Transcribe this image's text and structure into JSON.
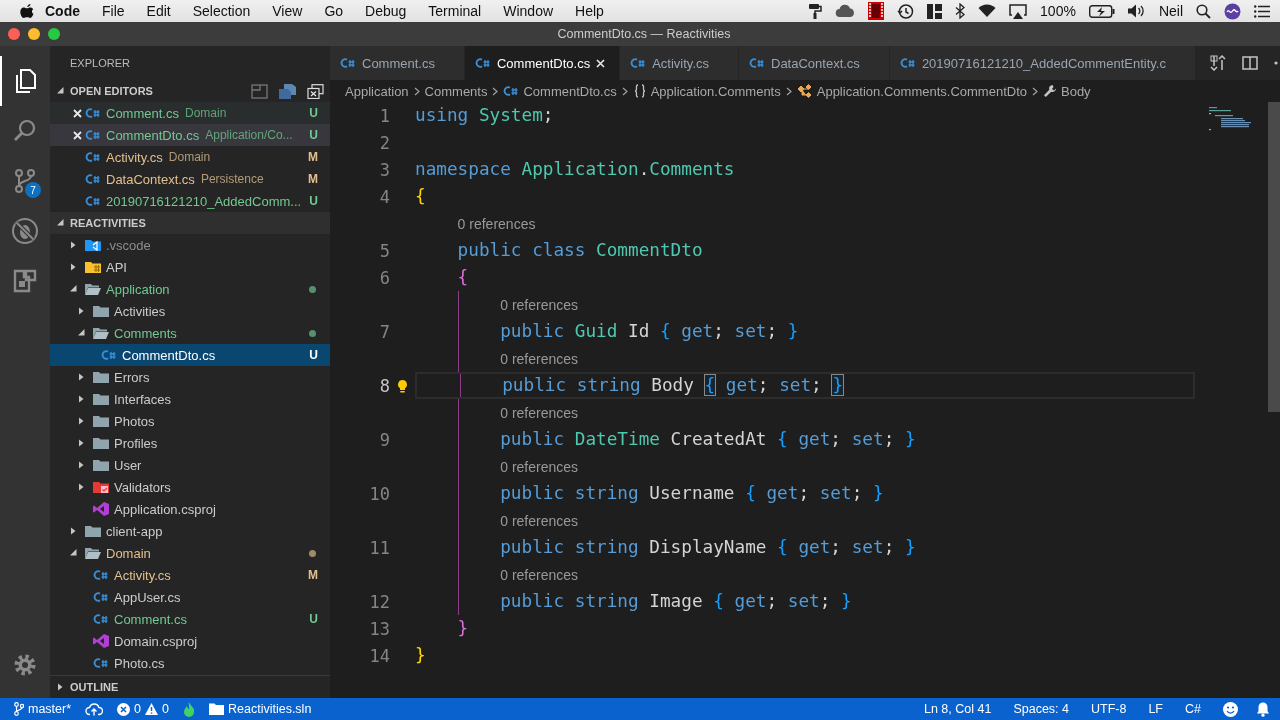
{
  "menubar": {
    "app": "Code",
    "menus": [
      "File",
      "Edit",
      "Selection",
      "View",
      "Go",
      "Debug",
      "Terminal",
      "Window",
      "Help"
    ],
    "battery": "100%",
    "user": "Neil"
  },
  "window": {
    "title": "CommentDto.cs — Reactivities"
  },
  "activity_bar": [
    {
      "kind": "explorer",
      "selected": true
    },
    {
      "kind": "search",
      "selected": false
    },
    {
      "kind": "scm",
      "selected": false,
      "badge": "7"
    },
    {
      "kind": "debug",
      "selected": false
    },
    {
      "kind": "extensions",
      "selected": false
    },
    {
      "kind": "settings",
      "selected": false
    }
  ],
  "sidebar": {
    "title": "EXPLORER",
    "open_editors": {
      "title": "OPEN EDITORS",
      "expanded": true,
      "items": [
        {
          "name": "Comment.cs",
          "detail": "Domain",
          "badge": "U",
          "color": "#73c991",
          "selected": false,
          "hovered": true
        },
        {
          "name": "CommentDto.cs",
          "detail": "Application/Co...",
          "badge": "U",
          "color": "#73c991",
          "selected": true,
          "hovered": false
        },
        {
          "name": "Activity.cs",
          "detail": "Domain",
          "badge": "M",
          "color": "#e2c08d",
          "selected": false,
          "hovered": false
        },
        {
          "name": "DataContext.cs",
          "detail": "Persistence",
          "badge": "M",
          "color": "#e2c08d",
          "selected": false,
          "hovered": false
        },
        {
          "name": "20190716121210_AddedComm...",
          "badge": "U",
          "color": "#73c991",
          "selected": false,
          "hovered": false
        }
      ]
    },
    "workspace": {
      "title": "REACTIVITIES",
      "expanded": true,
      "tree": [
        {
          "name": ".vscode",
          "kind": "vscode",
          "expanded": false,
          "selected": false,
          "changed": false,
          "color": "#8c8c8c"
        },
        {
          "name": "API",
          "kind": "api",
          "expanded": false,
          "selected": false,
          "changed": false,
          "color": "#cccccc"
        },
        {
          "name": "Application",
          "kind": "folder",
          "expanded": true,
          "selected": false,
          "changed": true,
          "color": "#73c991",
          "children": [
            {
              "name": "Activities",
              "kind": "folder",
              "expanded": false,
              "selected": false,
              "changed": false,
              "color": "#cccccc"
            },
            {
              "name": "Comments",
              "kind": "folder",
              "expanded": true,
              "selected": false,
              "changed": true,
              "color": "#73c991",
              "children": [
                {
                  "name": "CommentDto.cs",
                  "kind": "csharp",
                  "selected": true,
                  "color": "#ffffff",
                  "badge": "U"
                }
              ]
            },
            {
              "name": "Errors",
              "kind": "folder",
              "expanded": false,
              "selected": false,
              "changed": false,
              "color": "#cccccc"
            },
            {
              "name": "Interfaces",
              "kind": "folder",
              "expanded": false,
              "selected": false,
              "changed": false,
              "color": "#cccccc"
            },
            {
              "name": "Photos",
              "kind": "folder",
              "expanded": false,
              "selected": false,
              "changed": false,
              "color": "#cccccc"
            },
            {
              "name": "Profiles",
              "kind": "folder",
              "expanded": false,
              "selected": false,
              "changed": false,
              "color": "#cccccc"
            },
            {
              "name": "User",
              "kind": "folder",
              "expanded": false,
              "selected": false,
              "changed": false,
              "color": "#cccccc"
            },
            {
              "name": "Validators",
              "kind": "validators",
              "expanded": false,
              "selected": false,
              "changed": false,
              "color": "#cccccc"
            },
            {
              "name": "Application.csproj",
              "kind": "csproj",
              "selected": false,
              "color": "#cccccc"
            }
          ]
        },
        {
          "name": "client-app",
          "kind": "folder",
          "expanded": false,
          "selected": false,
          "changed": false,
          "color": "#cccccc"
        },
        {
          "name": "Domain",
          "kind": "folder",
          "expanded": true,
          "selected": false,
          "changed": true,
          "color": "#e2c08d",
          "children": [
            {
              "name": "Activity.cs",
              "kind": "csharp",
              "selected": false,
              "color": "#e2c08d",
              "badge": "M"
            },
            {
              "name": "AppUser.cs",
              "kind": "csharp",
              "selected": false,
              "color": "#cccccc"
            },
            {
              "name": "Comment.cs",
              "kind": "csharp",
              "selected": false,
              "color": "#73c991",
              "badge": "U"
            },
            {
              "name": "Domain.csproj",
              "kind": "csproj",
              "selected": false,
              "color": "#cccccc"
            },
            {
              "name": "Photo.cs",
              "kind": "csharp",
              "selected": false,
              "color": "#cccccc"
            }
          ]
        }
      ]
    },
    "outline": {
      "title": "OUTLINE",
      "expanded": false
    }
  },
  "editor": {
    "tabs": [
      {
        "label": "Comment.cs",
        "selected": false
      },
      {
        "label": "CommentDto.cs",
        "selected": true
      },
      {
        "label": "Activity.cs",
        "selected": false
      },
      {
        "label": "DataContext.cs",
        "selected": false
      },
      {
        "label": "20190716121210_AddedCommentEntity.c",
        "selected": false
      }
    ],
    "breadcrumbs": [
      {
        "text": "Application",
        "kind": "none"
      },
      {
        "text": "Comments",
        "kind": "none"
      },
      {
        "text": "CommentDto.cs",
        "kind": "csharp"
      },
      {
        "text": "Application.Comments",
        "kind": "namespace"
      },
      {
        "text": "Application.Comments.CommentDto",
        "kind": "class"
      },
      {
        "text": "Body",
        "kind": "property"
      }
    ],
    "lines": [
      {
        "number": "1",
        "current": false,
        "lightbulb": false,
        "tokens": [
          {
            "t": "using ",
            "kind": "kw"
          },
          {
            "t": "System",
            "kind": "type"
          },
          {
            "t": ";",
            "kind": "plain"
          }
        ]
      },
      {
        "number": "2",
        "current": false,
        "lightbulb": false
      },
      {
        "number": "3",
        "current": false,
        "lightbulb": false,
        "tokens": [
          {
            "t": "namespace ",
            "kind": "kw"
          },
          {
            "t": "Application",
            "kind": "type"
          },
          {
            "t": ".",
            "kind": "plain"
          },
          {
            "t": "Comments",
            "kind": "type"
          }
        ]
      },
      {
        "number": "4",
        "current": false,
        "lightbulb": false,
        "bracket_match": false,
        "tokens": [
          {
            "t": "{",
            "kind": "b1"
          }
        ]
      },
      {
        "number": "5",
        "lens": "0 references",
        "current": false,
        "lightbulb": false,
        "tokens": [
          {
            "t": "public class ",
            "kind": "kw"
          },
          {
            "t": "CommentDto",
            "kind": "type"
          }
        ]
      },
      {
        "number": "6",
        "current": false,
        "lightbulb": false,
        "bracket_match": false,
        "tokens": [
          {
            "t": "{",
            "kind": "b2"
          }
        ]
      },
      {
        "number": "7",
        "lens": "0 references",
        "current": false,
        "lightbulb": false,
        "bracket_match": false,
        "tokens": [
          {
            "t": "public ",
            "kind": "kw"
          },
          {
            "t": "Guid ",
            "kind": "type"
          },
          {
            "t": "Id ",
            "kind": "plain"
          },
          {
            "t": "{",
            "kind": "b3"
          },
          {
            "t": " get",
            "kind": "kw"
          },
          {
            "t": "; ",
            "kind": "plain"
          },
          {
            "t": "set",
            "kind": "kw"
          },
          {
            "t": "; ",
            "kind": "plain"
          },
          {
            "t": "}",
            "kind": "b3"
          }
        ]
      },
      {
        "number": "8",
        "lens": "0 references",
        "current": true,
        "lightbulb": true,
        "bracket_match": true,
        "tokens": [
          {
            "t": "public string ",
            "kind": "kw"
          },
          {
            "t": "Body ",
            "kind": "plain"
          },
          {
            "t": "{",
            "kind": "b3"
          },
          {
            "t": " get",
            "kind": "kw"
          },
          {
            "t": "; ",
            "kind": "plain"
          },
          {
            "t": "set",
            "kind": "kw"
          },
          {
            "t": "; ",
            "kind": "plain"
          },
          {
            "t": "}",
            "kind": "b3"
          }
        ]
      },
      {
        "number": "9",
        "lens": "0 references",
        "current": false,
        "lightbulb": false,
        "bracket_match": false,
        "tokens": [
          {
            "t": "public ",
            "kind": "kw"
          },
          {
            "t": "DateTime ",
            "kind": "type"
          },
          {
            "t": "CreatedAt ",
            "kind": "plain"
          },
          {
            "t": "{",
            "kind": "b3"
          },
          {
            "t": " get",
            "kind": "kw"
          },
          {
            "t": "; ",
            "kind": "plain"
          },
          {
            "t": "set",
            "kind": "kw"
          },
          {
            "t": "; ",
            "kind": "plain"
          },
          {
            "t": "}",
            "kind": "b3"
          }
        ]
      },
      {
        "number": "10",
        "lens": "0 references",
        "current": false,
        "lightbulb": false,
        "bracket_match": false,
        "tokens": [
          {
            "t": "public string ",
            "kind": "kw"
          },
          {
            "t": "Username ",
            "kind": "plain"
          },
          {
            "t": "{",
            "kind": "b3"
          },
          {
            "t": " get",
            "kind": "kw"
          },
          {
            "t": "; ",
            "kind": "plain"
          },
          {
            "t": "set",
            "kind": "kw"
          },
          {
            "t": "; ",
            "kind": "plain"
          },
          {
            "t": "}",
            "kind": "b3"
          }
        ]
      },
      {
        "number": "11",
        "lens": "0 references",
        "current": false,
        "lightbulb": false,
        "bracket_match": false,
        "tokens": [
          {
            "t": "public string ",
            "kind": "kw"
          },
          {
            "t": "DisplayName ",
            "kind": "plain"
          },
          {
            "t": "{",
            "kind": "b3"
          },
          {
            "t": " get",
            "kind": "kw"
          },
          {
            "t": "; ",
            "kind": "plain"
          },
          {
            "t": "set",
            "kind": "kw"
          },
          {
            "t": "; ",
            "kind": "plain"
          },
          {
            "t": "}",
            "kind": "b3"
          }
        ]
      },
      {
        "number": "12",
        "lens": "0 references",
        "current": false,
        "lightbulb": false,
        "bracket_match": false,
        "tokens": [
          {
            "t": "public string ",
            "kind": "kw"
          },
          {
            "t": "Image ",
            "kind": "plain"
          },
          {
            "t": "{",
            "kind": "b3"
          },
          {
            "t": " get",
            "kind": "kw"
          },
          {
            "t": "; ",
            "kind": "plain"
          },
          {
            "t": "set",
            "kind": "kw"
          },
          {
            "t": "; ",
            "kind": "plain"
          },
          {
            "t": "}",
            "kind": "b3"
          }
        ]
      },
      {
        "number": "13",
        "current": false,
        "lightbulb": false,
        "bracket_match": false,
        "tokens": [
          {
            "t": "}",
            "kind": "b2"
          }
        ]
      },
      {
        "number": "14",
        "current": false,
        "lightbulb": false,
        "bracket_match": false,
        "tokens": [
          {
            "t": "}",
            "kind": "b1"
          }
        ]
      }
    ]
  },
  "status_bar": {
    "branch": "master*",
    "errors": "0",
    "warnings": "0",
    "solution": "Reactivities.sln",
    "right": [
      "Ln 8, Col 41",
      "Spaces: 4",
      "UTF-8",
      "LF",
      "C#"
    ]
  }
}
